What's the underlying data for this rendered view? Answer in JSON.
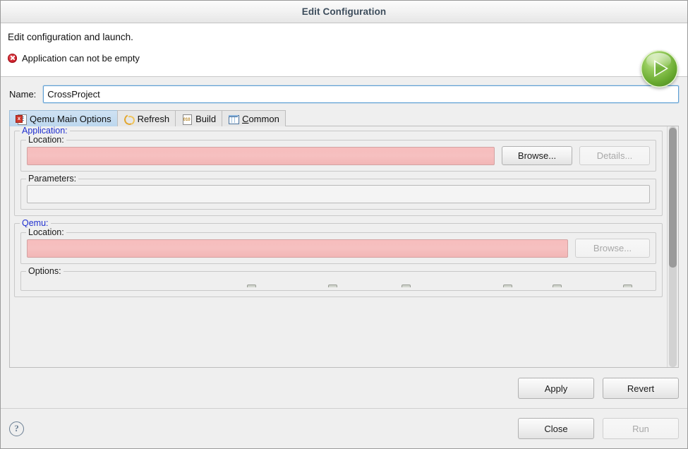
{
  "window": {
    "title": "Edit Configuration"
  },
  "header": {
    "title": "Edit configuration and launch.",
    "error_message": "Application can not be empty",
    "error_icon": "error-circle-icon",
    "run_badge_icon": "green-run-play-icon"
  },
  "name_field": {
    "label": "Name:",
    "value": "CrossProject",
    "placeholder": ""
  },
  "tabs": [
    {
      "label": "Qemu Main Options",
      "icon": "file-error-icon",
      "selected": true,
      "mnemonic": ""
    },
    {
      "label": "Refresh",
      "icon": "refresh-arrows-icon",
      "selected": false,
      "mnemonic": ""
    },
    {
      "label": "Build",
      "icon": "binary-file-icon",
      "selected": false,
      "mnemonic": ""
    },
    {
      "label": "Common",
      "icon": "window-table-icon",
      "selected": false,
      "mnemonic": "C"
    }
  ],
  "application_group": {
    "title": "Application:",
    "location": {
      "title": "Location:",
      "value": "",
      "error": true,
      "browse_label": "Browse...",
      "browse_enabled": true,
      "details_label": "Details...",
      "details_enabled": false
    },
    "parameters": {
      "title": "Parameters:",
      "value": ""
    }
  },
  "qemu_group": {
    "title": "Qemu:",
    "location": {
      "title": "Location:",
      "value": "",
      "error": true,
      "browse_label": "Browse...",
      "browse_enabled": false
    },
    "options": {
      "title": "Options:"
    }
  },
  "buttons": {
    "apply": "Apply",
    "revert": "Revert",
    "close": "Close",
    "run": "Run",
    "run_enabled": false
  },
  "footer": {
    "help_icon": "help-question-icon",
    "help_label": "?"
  },
  "colors": {
    "accent_blue": "#1f2fd0",
    "error_field": "#f5bcbc",
    "error_icon": "#cc1f2a",
    "tab_selected": "#c4dcf0",
    "title_text": "#3d4d5c",
    "run_badge_green": "#72b13a"
  }
}
